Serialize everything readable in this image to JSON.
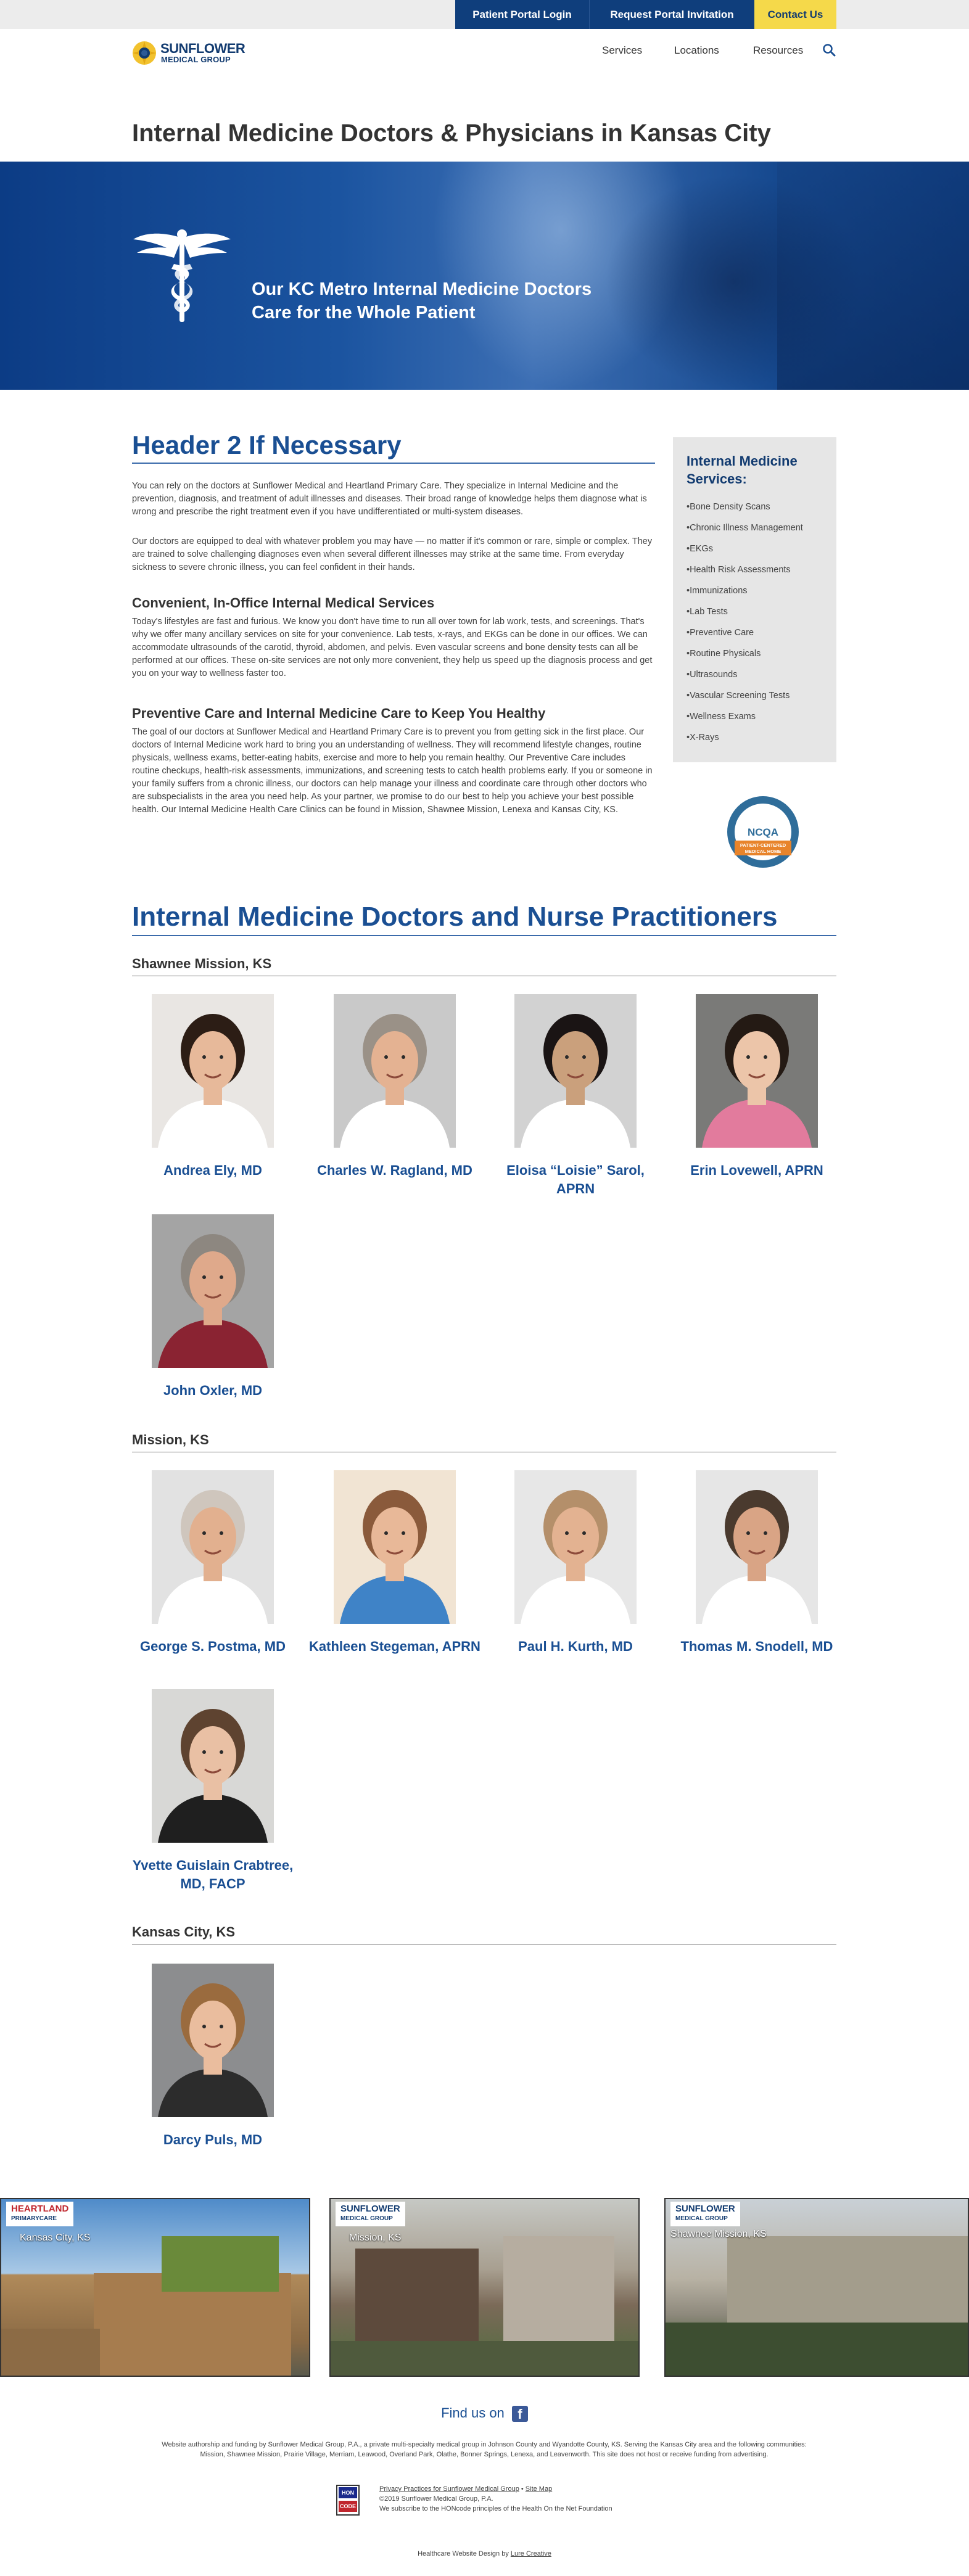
{
  "topbar": {
    "patient_portal": "Patient Portal Login",
    "request_invitation": "Request Portal Invitation",
    "contact": "Contact Us"
  },
  "logo": {
    "line1": "SUNFLOWER",
    "line2": "MEDICAL GROUP"
  },
  "nav": {
    "services": "Services",
    "locations": "Locations",
    "resources": "Resources"
  },
  "page_title": "Internal Medicine Doctors & Physicians in Kansas City",
  "hero": {
    "line1": "Our KC Metro Internal Medicine Doctors",
    "line2": "Care for the Whole Patient"
  },
  "content": {
    "header2": "Header 2 If Necessary",
    "p1": "You can rely on the doctors at Sunflower Medical and Heartland Primary Care. They specialize in Internal Medicine and the prevention, diagnosis, and treatment of adult illnesses and diseases. Their broad range of knowledge helps them diagnose what is wrong and prescribe the right treatment even if you have undifferentiated or multi-system diseases.",
    "p2": "Our doctors are equipped to deal with whatever problem you may have — no matter if it's common or rare, simple or complex. They are trained to solve challenging diagnoses even when several different illnesses may strike at the same time. From everyday sickness to severe chronic illness, you can feel confident in their hands.",
    "h3a": "Convenient, In-Office Internal Medical Services",
    "p3": "Today's lifestyles are fast and furious. We know you don't have time to run all over town for lab work, tests, and screenings. That's why we offer many ancillary services on site for your convenience. Lab tests, x-rays, and EKGs can be done in our offices. We can accommodate ultrasounds of the carotid, thyroid, abdomen, and pelvis. Even vascular screens and bone density tests can all be performed at our offices. These on-site services are not only more convenient, they help us speed up the diagnosis process and get you on your way to wellness faster too.",
    "h3b": "Preventive Care and Internal Medicine Care to Keep You Healthy",
    "p4": "The goal of our doctors at Sunflower Medical and Heartland Primary Care is to prevent you from getting sick in the first place. Our doctors of Internal Medicine work hard to bring you an understanding of wellness. They will recommend lifestyle changes, routine physicals, wellness exams, better-eating habits, exercise and more to help you remain healthy. Our Preventive Care includes routine checkups, health-risk assessments, immunizations, and screening tests to catch health problems early. If you or someone in your family suffers from a chronic illness, our doctors can help manage your illness and coordinate care through other doctors who are subspecialists in the area you need help. As your partner, we promise to do our best to help you achieve your best possible health. Our Internal Medicine Health Care Clinics can be found in Mission, Shawnee Mission, Lenexa and Kansas City, KS."
  },
  "sidebar": {
    "title_line1": "Internal Medicine",
    "title_line2": "Services:",
    "items": [
      "Bone Density Scans",
      "Chronic Illness Management",
      "EKGs",
      "Health Risk Assessments",
      "Immunizations",
      "Lab Tests",
      "Preventive Care",
      "Routine Physicals",
      "Ultrasounds",
      "Vascular Screening Tests",
      "Wellness Exams",
      "X-Rays"
    ]
  },
  "badge": {
    "top": "RECOGNIZED",
    "middle": "NCQA",
    "bottom1": "PATIENT-CENTERED",
    "bottom2": "MEDICAL HOME"
  },
  "doctors_header": "Internal Medicine Doctors and Nurse Practitioners",
  "locations": [
    {
      "name": "Shawnee Mission, KS",
      "doctors": [
        {
          "name": "Andrea Ely, MD",
          "bg": "#e9e6e3",
          "hair": "#2c1d15",
          "skin": "#e7b99a",
          "shirt": "#ffffff"
        },
        {
          "name": "Charles W. Ragland, MD",
          "bg": "#c9c9c9",
          "hair": "#9a9187",
          "skin": "#e4b292",
          "shirt": "#ffffff"
        },
        {
          "name": "Eloisa “Loisie” Sarol, APRN",
          "bg": "#d2d2d2",
          "hair": "#1a1414",
          "skin": "#caa07c",
          "shirt": "#ffffff"
        },
        {
          "name": "Erin Lovewell, APRN",
          "bg": "#7a7a78",
          "hair": "#241a14",
          "skin": "#ecc5a9",
          "shirt": "#e27b9d"
        },
        {
          "name": "John Oxler, MD",
          "bg": "#a4a4a4",
          "hair": "#8d8780",
          "skin": "#dfa98b",
          "shirt": "#8a2332"
        }
      ]
    },
    {
      "name": "Mission, KS",
      "doctors": [
        {
          "name": "George S. Postma, MD",
          "bg": "#e2e2e2",
          "hair": "#cfc6bd",
          "skin": "#e2b08f",
          "shirt": "#ffffff"
        },
        {
          "name": "Kathleen Stegeman, APRN",
          "bg": "#f1e4d3",
          "hair": "#8a5a3b",
          "skin": "#e8b898",
          "shirt": "#3f83c7"
        },
        {
          "name": "Paul H. Kurth, MD",
          "bg": "#e7e7e7",
          "hair": "#b48f6a",
          "skin": "#e3b291",
          "shirt": "#ffffff"
        },
        {
          "name": "Thomas M. Snodell, MD",
          "bg": "#e6e6e6",
          "hair": "#4a3a2e",
          "skin": "#d9a485",
          "shirt": "#ffffff"
        },
        {
          "name": "Yvette Guislain Crabtree, MD, FACP",
          "bg": "#d8d8d6",
          "hair": "#5e4330",
          "skin": "#e9c0a4",
          "shirt": "#1f1f1f"
        }
      ]
    },
    {
      "name": "Kansas City, KS",
      "doctors": [
        {
          "name": "Darcy Puls, MD",
          "bg": "#8c8d8f",
          "hair": "#9a6b3e",
          "skin": "#eabd9e",
          "shirt": "#2c2c2c"
        }
      ]
    }
  ],
  "office_photos": [
    {
      "brand1": "HEARTLAND",
      "brand2": "PRIMARYCARE",
      "city": "Kansas City, KS"
    },
    {
      "brand1": "SUNFLOWER",
      "brand2": "MEDICAL GROUP",
      "city": "Mission, KS"
    },
    {
      "brand1": "SUNFLOWER",
      "brand2": "MEDICAL GROUP",
      "city": "Shawnee Mission, KS"
    }
  ],
  "footer": {
    "find_us": "Find us on",
    "fb": "f",
    "text1": "Website authorship and funding by Sunflower Medical Group, P.A., a private multi-specialty medical group in Johnson County and Wyandotte County, KS. Serving the Kansas City area and the following communities:",
    "text2": "Mission, Shawnee Mission, Prairie Village, Merriam, Leawood, Overland Park, Olathe, Bonner Springs, Lenexa, and Leavenworth. This site does not host or receive funding from advertising.",
    "privacy": "Privacy Practices for Sunflower Medical Group",
    "sep": "•",
    "sitemap": "Site Map",
    "copyright": "©2019 Sunflower Medical Group, P.A.",
    "honcode": "We subscribe to the HONcode principles of the Health On the Net Foundation",
    "hon1": "HON",
    "hon2": "CODE",
    "design_prefix": "Healthcare Website Design by",
    "design_link": "Lure Creative"
  },
  "colors": {
    "navy": "#0f3e7c",
    "accent_blue": "#1a4f93",
    "yellow": "#f5d94a"
  }
}
